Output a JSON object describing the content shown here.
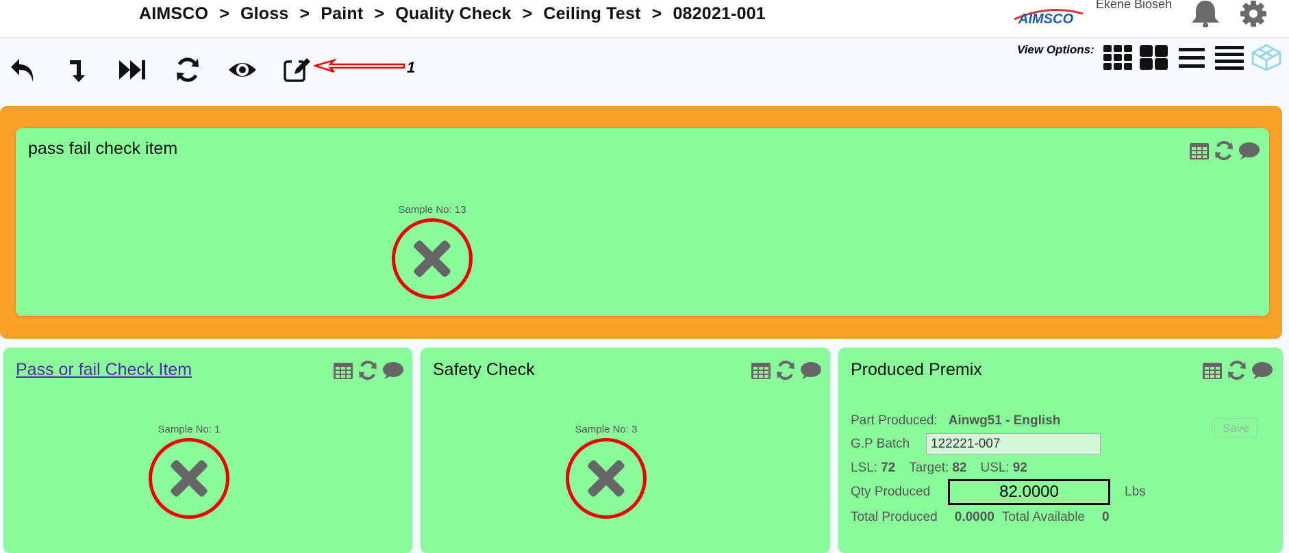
{
  "breadcrumb": [
    "AIMSCO",
    "Gloss",
    "Paint",
    "Quality Check",
    "Ceiling Test",
    "082021-001"
  ],
  "breadcrumb_separator": ">",
  "logo_text": "AIMSCO",
  "user_name": "Ekene Bioseh",
  "annotation_number": "1",
  "view_options_label": "View Options:",
  "cards": {
    "main": {
      "title": "pass fail check item",
      "sample_label": "Sample No: 13"
    },
    "pass_fail": {
      "title": "Pass or fail Check Item",
      "sample_label": "Sample No: 1"
    },
    "safety": {
      "title": "Safety Check",
      "sample_label": "Sample No: 3"
    },
    "premix": {
      "title": "Produced Premix",
      "part_label": "Part Produced:",
      "part_value": "Ainwg51 - English",
      "gp_label": "G.P Batch",
      "gp_value": "122221-007",
      "lsl_label": "LSL:",
      "lsl_value": "72",
      "target_label": "Target:",
      "target_value": "82",
      "usl_label": "USL:",
      "usl_value": "92",
      "qty_label": "Qty Produced",
      "qty_value": "82.0000",
      "qty_unit": "Lbs",
      "total_produced_label": "Total Produced",
      "total_produced_value": "0.0000",
      "total_available_label": "Total Available",
      "total_available_value": "0",
      "save_label": "Save"
    }
  },
  "colors": {
    "card_green": "#8afb9a",
    "orange_band": "#f9a128",
    "fail_red": "#e00000",
    "icon_gray": "#666666"
  },
  "icons": {
    "toolbar": [
      "undo-icon",
      "step-down-icon",
      "fast-forward-icon",
      "refresh-icon",
      "eye-icon",
      "edit-icon"
    ],
    "view_options": [
      "grid-small-icon",
      "grid-large-icon",
      "list-icon",
      "list-dense-icon",
      "cube-icon"
    ],
    "card_tools": [
      "table-icon",
      "refresh-icon",
      "comment-icon"
    ]
  }
}
